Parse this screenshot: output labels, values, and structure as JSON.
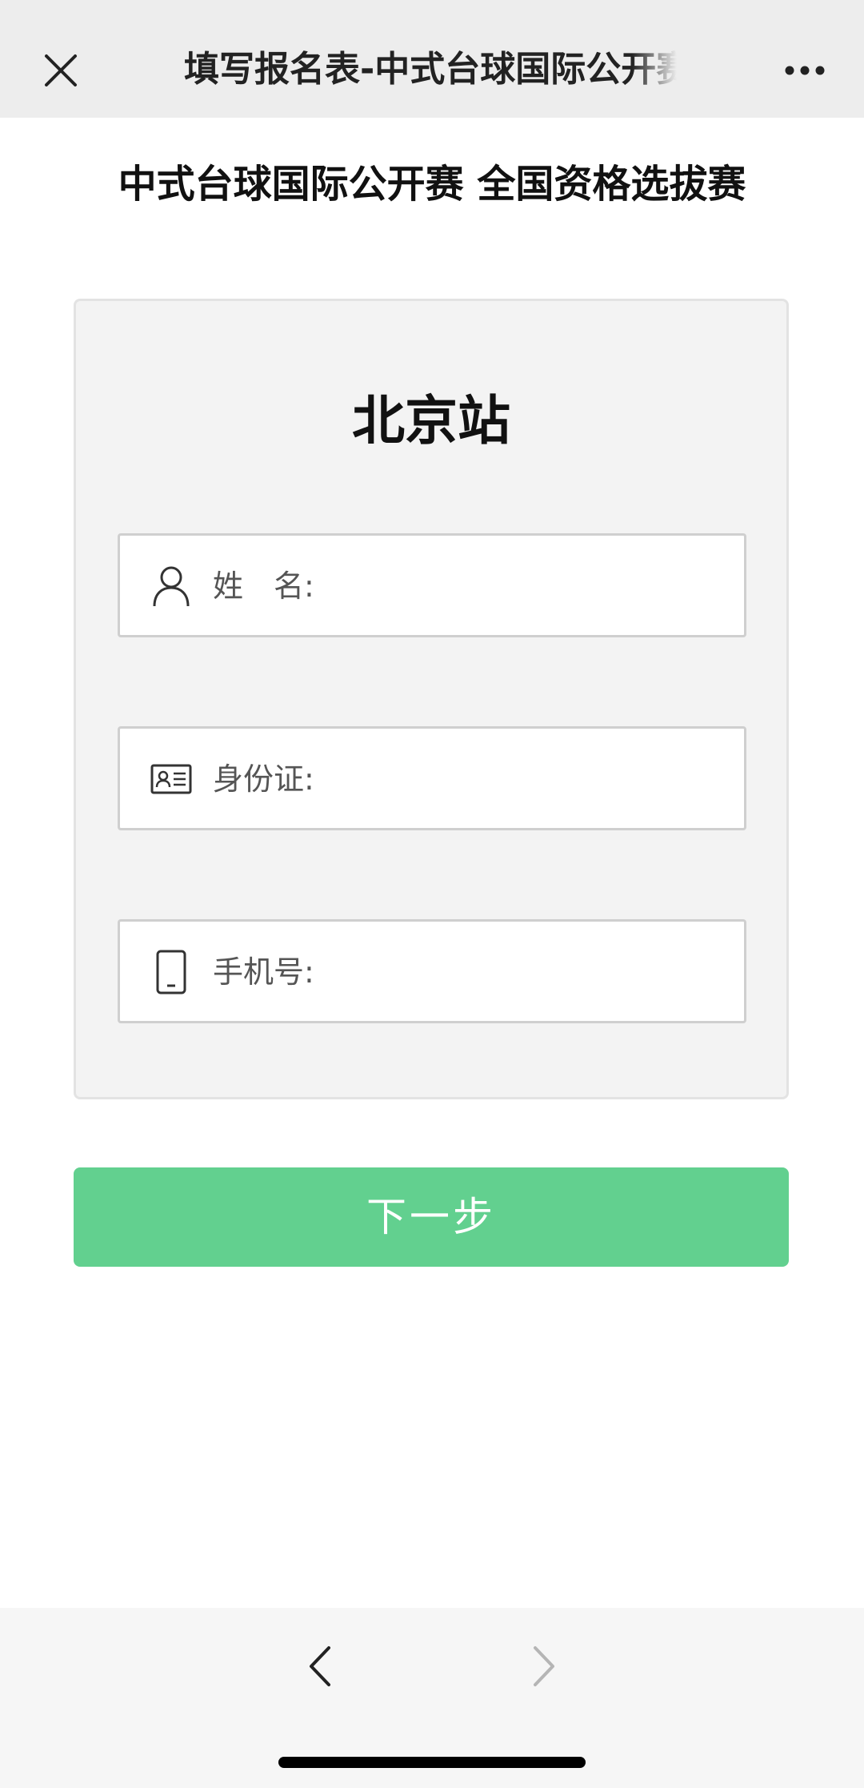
{
  "topbar": {
    "title": "填写报名表-中式台球国际公开赛",
    "close_icon": "close-icon",
    "more_icon": "more-icon"
  },
  "page": {
    "heading": "中式台球国际公开赛 全国资格选拔赛"
  },
  "form": {
    "station": "北京站",
    "fields": [
      {
        "icon": "person-icon",
        "label": "姓　名:",
        "value": ""
      },
      {
        "icon": "id-card-icon",
        "label": "身份证:",
        "value": ""
      },
      {
        "icon": "phone-icon",
        "label": "手机号:",
        "value": ""
      }
    ],
    "next_label": "下一步"
  },
  "colors": {
    "accent": "#62d08f",
    "topbar_bg": "#ededed",
    "card_bg": "#f3f3f3"
  },
  "bottombar": {
    "back_icon": "back-arrow-icon",
    "forward_icon": "forward-arrow-icon",
    "forward_enabled": false
  }
}
